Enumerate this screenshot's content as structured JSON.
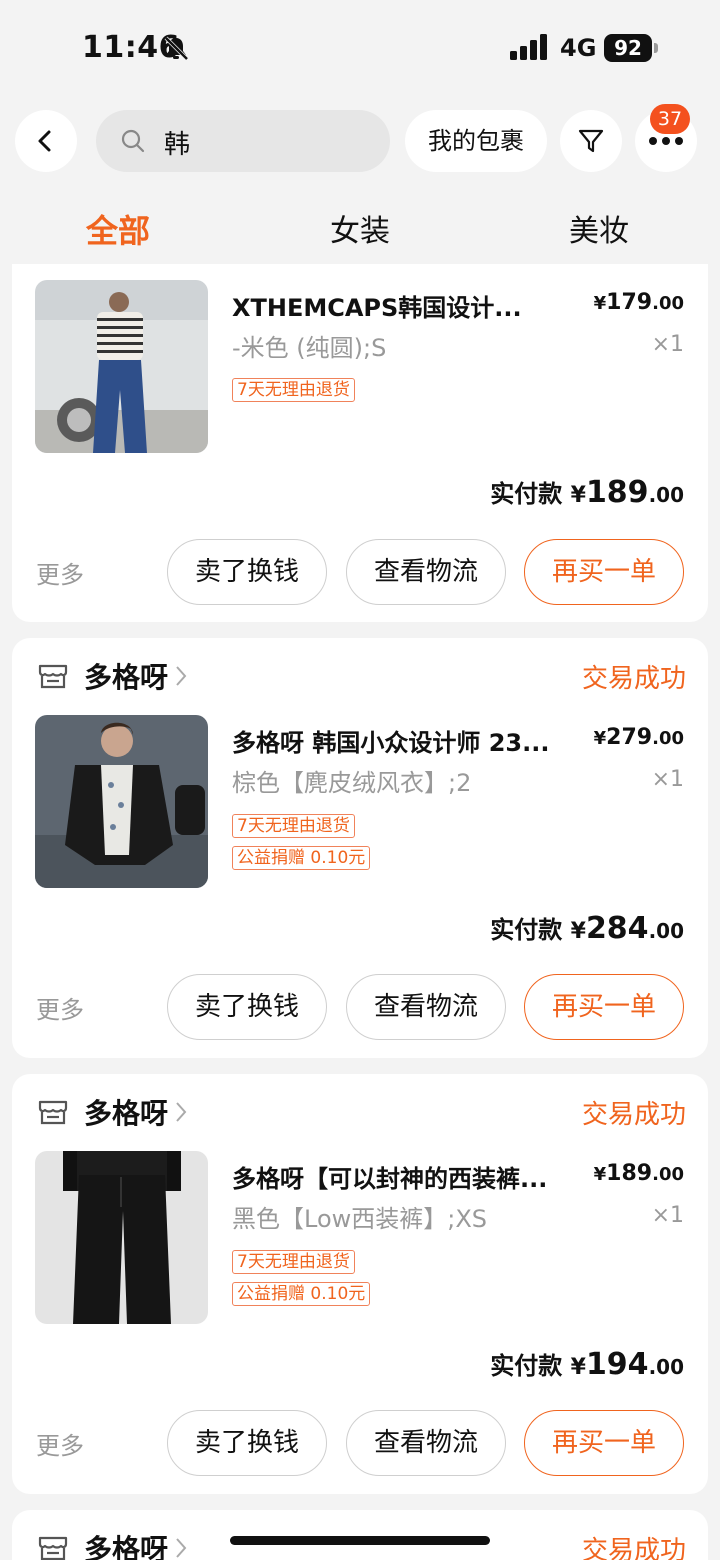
{
  "status_bar": {
    "time": "11:46",
    "network": "4G",
    "battery": "92"
  },
  "header": {
    "search_value": "韩",
    "parcel_label": "我的包裹",
    "more_badge": "37"
  },
  "tabs": [
    {
      "label": "全部",
      "active": true
    },
    {
      "label": "女装",
      "active": false
    },
    {
      "label": "美妆",
      "active": false
    }
  ],
  "orders": [
    {
      "product": {
        "title": "XTHEMCAPS韩国设计...",
        "spec": "-米色 (纯圆);S",
        "price_int": "179",
        "price_dec": ".00",
        "qty": "×1",
        "tags": [
          "7天无理由退货"
        ]
      },
      "paid_label": "实付款",
      "paid_int": "189",
      "paid_dec": ".00",
      "actions": {
        "more": "更多",
        "sell": "卖了换钱",
        "track": "查看物流",
        "rebuy": "再买一单"
      }
    },
    {
      "shop": "多格呀",
      "status": "交易成功",
      "product": {
        "title": "多格呀 韩国小众设计师 23...",
        "spec": "棕色【麂皮绒风衣】;2",
        "price_int": "279",
        "price_dec": ".00",
        "qty": "×1",
        "tags": [
          "7天无理由退货",
          "公益捐赠 0.10元"
        ]
      },
      "paid_label": "实付款",
      "paid_int": "284",
      "paid_dec": ".00",
      "actions": {
        "more": "更多",
        "sell": "卖了换钱",
        "track": "查看物流",
        "rebuy": "再买一单"
      }
    },
    {
      "shop": "多格呀",
      "status": "交易成功",
      "product": {
        "title": "多格呀【可以封神的西装裤...",
        "spec": "黑色【Low西装裤】;XS",
        "price_int": "189",
        "price_dec": ".00",
        "qty": "×1",
        "tags": [
          "7天无理由退货",
          "公益捐赠 0.10元"
        ]
      },
      "paid_label": "实付款",
      "paid_int": "194",
      "paid_dec": ".00",
      "actions": {
        "more": "更多",
        "sell": "卖了换钱",
        "track": "查看物流",
        "rebuy": "再买一单"
      }
    },
    {
      "shop": "多格呀",
      "status": "交易成功"
    }
  ],
  "currency_symbol": "¥",
  "icons": [
    "bell-off-icon",
    "signal-icon",
    "back-arrow-icon",
    "search-icon",
    "filter-icon",
    "more-dots-icon",
    "shop-icon",
    "chevron-right-icon"
  ],
  "colors": {
    "accent": "#f0641e",
    "badge": "#f4511e",
    "background": "#f3f3f3"
  }
}
